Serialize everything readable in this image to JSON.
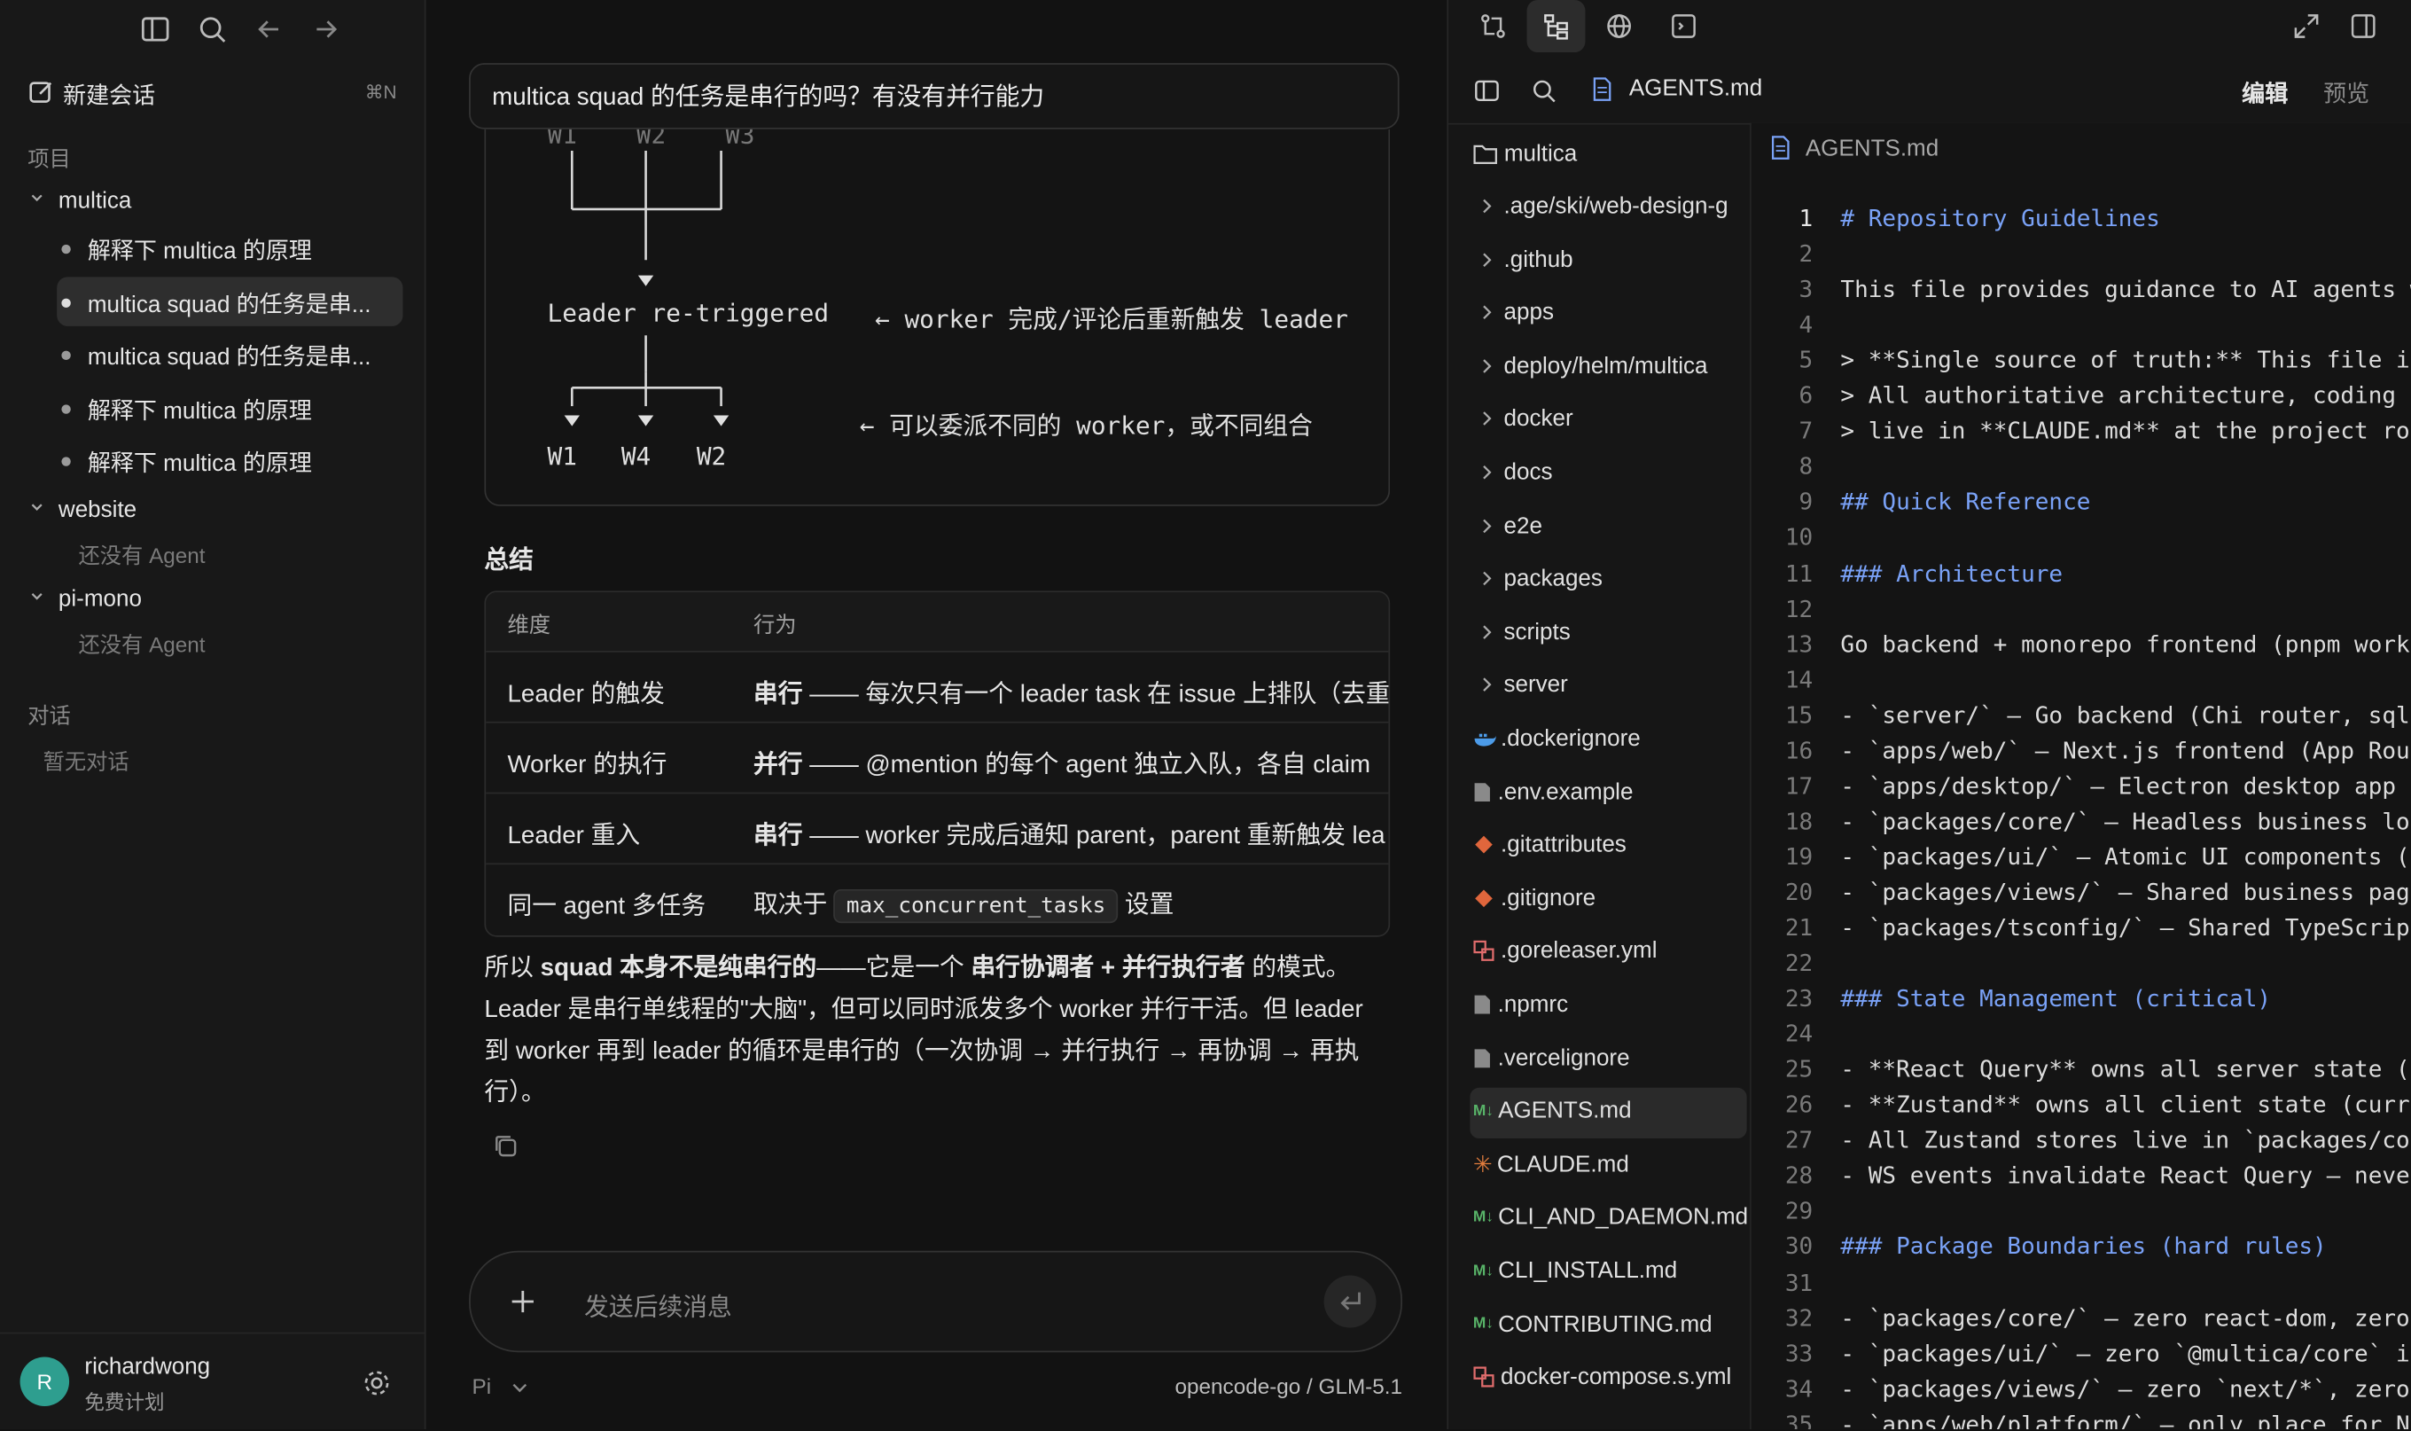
{
  "sidebar": {
    "new_chat_label": "新建会话",
    "new_chat_shortcut": "⌘N",
    "projects_section": "项目",
    "projects": [
      {
        "name": "multica",
        "conversations": [
          "解释下 multica 的原理",
          "multica squad 的任务是串...",
          "multica squad 的任务是串...",
          "解释下 multica 的原理",
          "解释下 multica 的原理"
        ],
        "active_index": 1
      },
      {
        "name": "website",
        "empty": "还没有 Agent"
      },
      {
        "name": "pi-mono",
        "empty": "还没有 Agent"
      }
    ],
    "chats_section": "对话",
    "chats_empty": "暂无对话",
    "user": {
      "initial": "R",
      "name": "richardwong",
      "plan": "免费计划"
    }
  },
  "main": {
    "query": "multica squad 的任务是串行的吗？有没有并行能力",
    "diagram": {
      "top_labels": "W1    W2    W3",
      "leader_text": "Leader re-triggered",
      "leader_note": "← worker 完成/评论后重新触发 leader",
      "delegate_note": "← 可以委派不同的 worker，或不同组合",
      "worker_1": "W1",
      "worker_2": "W4",
      "worker_3": "W2"
    },
    "summary_title": "总结",
    "table": {
      "headers": [
        "维度",
        "行为"
      ],
      "rows": [
        {
          "dim": "Leader 的触发",
          "bold": "串行",
          "text": " —— 每次只有一个 leader task 在 issue 上排队（去重"
        },
        {
          "dim": "Worker 的执行",
          "bold": "并行",
          "text": " —— @mention 的每个 agent 独立入队，各自 claim"
        },
        {
          "dim": "Leader 重入",
          "bold": "串行",
          "text": " —— worker 完成后通知 parent，parent 重新触发 lea"
        },
        {
          "dim": "同一 agent 多任务",
          "prefix": "取决于 ",
          "code": "max_concurrent_tasks",
          "suffix": " 设置"
        }
      ]
    },
    "paragraph": {
      "p1": "所以 ",
      "b1": "squad 本身不是纯串行的",
      "p2": "——它是一个 ",
      "b2": "串行协调者 + 并行执行者",
      "p3": " 的模式。Leader 是串行单线程的\"大脑\"，但可以同时派发多个 worker 并行干活。但 leader 到 worker 再到 leader 的循环是串行的（一次协调 → 并行执行 → 再协调 → 再执行）。"
    },
    "composer_placeholder": "发送后续消息",
    "agent_selector": "Pi",
    "model_label": "opencode-go / GLM-5.1"
  },
  "right_panel": {
    "file_tab": "AGENTS.md",
    "edit_label": "编辑",
    "preview_label": "预览",
    "root_folder": "multica",
    "editor_file": "AGENTS.md",
    "tree": [
      {
        "name": ".age/ski/web-design-g",
        "type": "folder"
      },
      {
        "name": ".github",
        "type": "folder"
      },
      {
        "name": "apps",
        "type": "folder"
      },
      {
        "name": "deploy/helm/multica",
        "type": "folder"
      },
      {
        "name": "docker",
        "type": "folder"
      },
      {
        "name": "docs",
        "type": "folder"
      },
      {
        "name": "e2e",
        "type": "folder"
      },
      {
        "name": "packages",
        "type": "folder"
      },
      {
        "name": "scripts",
        "type": "folder"
      },
      {
        "name": "server",
        "type": "folder"
      },
      {
        "name": ".dockerignore",
        "type": "docker"
      },
      {
        "name": ".env.example",
        "type": "file"
      },
      {
        "name": ".gitattributes",
        "type": "git"
      },
      {
        "name": ".gitignore",
        "type": "git"
      },
      {
        "name": ".goreleaser.yml",
        "type": "yml"
      },
      {
        "name": ".npmrc",
        "type": "file"
      },
      {
        "name": ".vercelignore",
        "type": "file"
      },
      {
        "name": "AGENTS.md",
        "type": "md",
        "selected": true
      },
      {
        "name": "CLAUDE.md",
        "type": "claude"
      },
      {
        "name": "CLI_AND_DAEMON.md",
        "type": "md"
      },
      {
        "name": "CLI_INSTALL.md",
        "type": "md"
      },
      {
        "name": "CONTRIBUTING.md",
        "type": "md"
      },
      {
        "name": "docker-compose.s.yml",
        "type": "yml"
      }
    ],
    "code_lines": [
      "# Repository Guidelines",
      "",
      "This file provides guidance to AI agents w",
      "",
      "> **Single source of truth:** This file is",
      "> All authoritative architecture, coding",
      "> live in **CLAUDE.md** at the project roo",
      "",
      "## Quick Reference",
      "",
      "### Architecture",
      "",
      "Go backend + monorepo frontend (pnpm works",
      "",
      "- `server/` — Go backend (Chi router, sqlc",
      "- `apps/web/` — Next.js frontend (App Rout",
      "- `apps/desktop/` — Electron desktop app",
      "- `packages/core/` — Headless business log",
      "- `packages/ui/` — Atomic UI components (z",
      "- `packages/views/` — Shared business page",
      "- `packages/tsconfig/` — Shared TypeScript",
      "",
      "### State Management (critical)",
      "",
      "- **React Query** owns all server state (",
      "- **Zustand** owns all client state (curre",
      "- All Zustand stores live in `packages/co",
      "- WS events invalidate React Query — neve",
      "",
      "### Package Boundaries (hard rules)",
      "",
      "- `packages/core/` — zero react-dom, zero",
      "- `packages/ui/` — zero `@multica/core` im",
      "- `packages/views/` — zero `next/*`, zero",
      "- `apps/web/platform/` — only place for N"
    ],
    "line_numbers": [
      "1",
      "2",
      "3",
      "4",
      "5",
      "6",
      "7",
      "8",
      "9",
      "10",
      "11",
      "12",
      "13",
      "14",
      "15",
      "16",
      "17",
      "18",
      "19",
      "20",
      "21",
      "22",
      "23",
      "24",
      "25",
      "26",
      "27",
      "28",
      "29",
      "30",
      "31",
      "32",
      "33",
      "34",
      "35"
    ]
  },
  "colors": {
    "bg": "#121212",
    "sidebar_bg": "#181818",
    "heading": "#7aa2f7",
    "quote_marker": "#e06c75",
    "avatar": "#2e9e8f"
  }
}
